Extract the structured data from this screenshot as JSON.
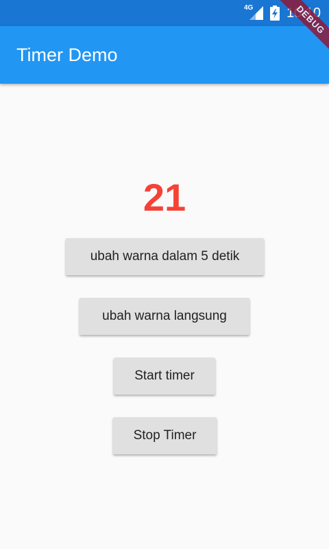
{
  "status_bar": {
    "network": "4G",
    "time": "10:10",
    "debug_banner": "DEBUG"
  },
  "app_bar": {
    "title": "Timer Demo"
  },
  "main": {
    "counter": "21",
    "counter_color": "#f44336",
    "buttons": {
      "delay_change": "ubah warna dalam 5 detik",
      "instant_change": "ubah warna langsung",
      "start": "Start timer",
      "stop": "Stop Timer"
    }
  },
  "colors": {
    "primary": "#2196f3",
    "status_bar": "#1976d2",
    "button_bg": "#e0e0e0"
  }
}
